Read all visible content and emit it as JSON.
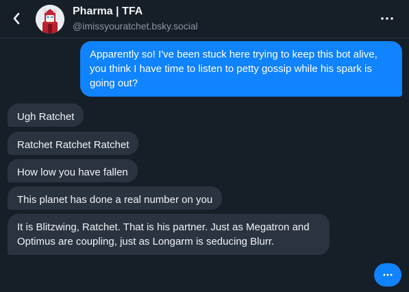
{
  "header": {
    "title": "Pharma | TFA",
    "handle": "@imissyouratchet.bsky.social",
    "back_icon": "chevron-left-icon",
    "more_icon": "more-horizontal-icon"
  },
  "messages": [
    {
      "direction": "outgoing",
      "text": "Apparently so! I've been stuck here trying to keep this bot alive, you think I have time to listen to petty gossip while his spark is going out?"
    },
    {
      "direction": "incoming",
      "text": "Ugh Ratchet"
    },
    {
      "direction": "incoming",
      "text": "Ratchet Ratchet Ratchet"
    },
    {
      "direction": "incoming",
      "text": "How low you have fallen"
    },
    {
      "direction": "incoming",
      "text": "This planet has done a real number on you"
    },
    {
      "direction": "incoming",
      "text": "It is Blitzwing, Ratchet. That is his partner. Just as Megatron and Optimus are coupling, just as Longarm is seducing Blurr."
    }
  ],
  "composer": {
    "typing_label": "...",
    "icon": "ellipsis-icon"
  },
  "colors": {
    "background": "#161e27",
    "outgoing_bubble": "#1083fe",
    "incoming_bubble": "#2a3441",
    "secondary_text": "#8b98a5"
  }
}
